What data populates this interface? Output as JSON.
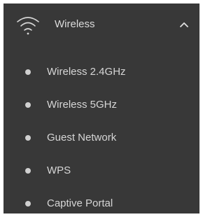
{
  "menu": {
    "header": {
      "label": "Wireless",
      "icon": "wifi-icon",
      "expanded": true,
      "toggle_icon": "chevron-up-icon"
    },
    "items": [
      {
        "label": "Wireless 2.4GHz"
      },
      {
        "label": "Wireless 5GHz"
      },
      {
        "label": "Guest Network"
      },
      {
        "label": "WPS"
      },
      {
        "label": "Captive Portal"
      }
    ]
  },
  "colors": {
    "panel_background": "#383838",
    "text": "#d6d6d6",
    "bullet": "#d0d0d0",
    "page_background": "#ffffff"
  }
}
